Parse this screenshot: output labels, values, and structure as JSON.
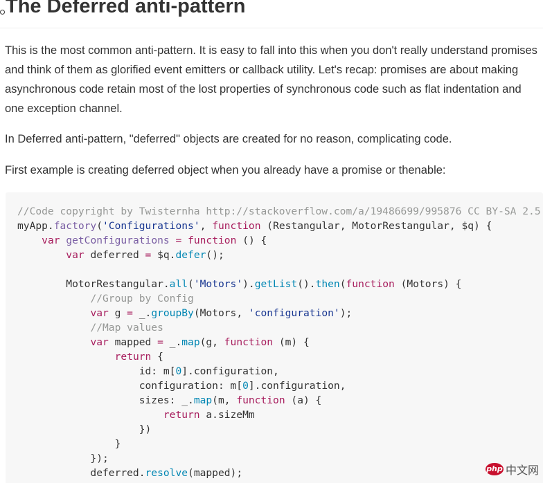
{
  "heading": {
    "title": "The Deferred anti-pattern"
  },
  "paragraphs": [
    "This is the most common anti-pattern. It is easy to fall into this when you don't really understand promises and think of them as glorified event emitters or callback utility. Let's recap: promises are about making asynchronous code retain most of the lost properties of synchronous code such as flat indentation and one exception channel.",
    "In Deferred anti-pattern, \"deferred\" objects are created for no reason, complicating code.",
    "First example is creating deferred object when you already have a promise or thenable:"
  ],
  "code": {
    "language": "javascript",
    "lines": [
      [
        [
          "cm",
          "//Code copyright by Twisternha http://stackoverflow.com/a/19486699/995876 CC BY-SA 2.5"
        ]
      ],
      [
        [
          "",
          "myApp."
        ],
        [
          "fn",
          "factory"
        ],
        [
          "",
          "("
        ],
        [
          "st",
          "'Configurations'"
        ],
        [
          "",
          ", "
        ],
        [
          "kw",
          "function"
        ],
        [
          "",
          " (Restangular, MotorRestangular, $q) {"
        ]
      ],
      [
        [
          "",
          "    "
        ],
        [
          "kw",
          "var"
        ],
        [
          "",
          " "
        ],
        [
          "fn",
          "getConfigurations"
        ],
        [
          "",
          " "
        ],
        [
          "kw",
          "="
        ],
        [
          "",
          " "
        ],
        [
          "kw",
          "function"
        ],
        [
          "",
          " () {"
        ]
      ],
      [
        [
          "",
          "        "
        ],
        [
          "kw",
          "var"
        ],
        [
          "",
          " deferred "
        ],
        [
          "kw",
          "="
        ],
        [
          "",
          " $q."
        ],
        [
          "pr",
          "defer"
        ],
        [
          "",
          "();"
        ]
      ],
      [
        [
          "",
          ""
        ]
      ],
      [
        [
          "",
          "        MotorRestangular."
        ],
        [
          "pr",
          "all"
        ],
        [
          "",
          "("
        ],
        [
          "st",
          "'Motors'"
        ],
        [
          "",
          ")."
        ],
        [
          "pr",
          "getList"
        ],
        [
          "",
          "()."
        ],
        [
          "pr",
          "then"
        ],
        [
          "",
          "("
        ],
        [
          "kw",
          "function"
        ],
        [
          "",
          " (Motors) {"
        ]
      ],
      [
        [
          "",
          "            "
        ],
        [
          "cm",
          "//Group by Config"
        ]
      ],
      [
        [
          "",
          "            "
        ],
        [
          "kw",
          "var"
        ],
        [
          "",
          " g "
        ],
        [
          "kw",
          "="
        ],
        [
          "",
          " _."
        ],
        [
          "pr",
          "groupBy"
        ],
        [
          "",
          "(Motors, "
        ],
        [
          "st",
          "'configuration'"
        ],
        [
          "",
          ");"
        ]
      ],
      [
        [
          "",
          "            "
        ],
        [
          "cm",
          "//Map values"
        ]
      ],
      [
        [
          "",
          "            "
        ],
        [
          "kw",
          "var"
        ],
        [
          "",
          " mapped "
        ],
        [
          "kw",
          "="
        ],
        [
          "",
          " _."
        ],
        [
          "pr",
          "map"
        ],
        [
          "",
          "(g, "
        ],
        [
          "kw",
          "function"
        ],
        [
          "",
          " (m) {"
        ]
      ],
      [
        [
          "",
          "                "
        ],
        [
          "kw",
          "return"
        ],
        [
          "",
          " {"
        ]
      ],
      [
        [
          "",
          "                    id: m["
        ],
        [
          "nu",
          "0"
        ],
        [
          "",
          "].configuration,"
        ]
      ],
      [
        [
          "",
          "                    configuration: m["
        ],
        [
          "nu",
          "0"
        ],
        [
          "",
          "].configuration,"
        ]
      ],
      [
        [
          "",
          "                    sizes: _."
        ],
        [
          "pr",
          "map"
        ],
        [
          "",
          "(m, "
        ],
        [
          "kw",
          "function"
        ],
        [
          "",
          " (a) {"
        ]
      ],
      [
        [
          "",
          "                        "
        ],
        [
          "kw",
          "return"
        ],
        [
          "",
          " a.sizeMm"
        ]
      ],
      [
        [
          "",
          "                    })"
        ]
      ],
      [
        [
          "",
          "                }"
        ]
      ],
      [
        [
          "",
          "            });"
        ]
      ],
      [
        [
          "",
          "            deferred."
        ],
        [
          "pr",
          "resolve"
        ],
        [
          "",
          "(mapped);"
        ]
      ],
      [
        [
          "",
          "        });"
        ]
      ]
    ]
  },
  "watermark": {
    "logo_text": "php",
    "text": "中文网"
  }
}
